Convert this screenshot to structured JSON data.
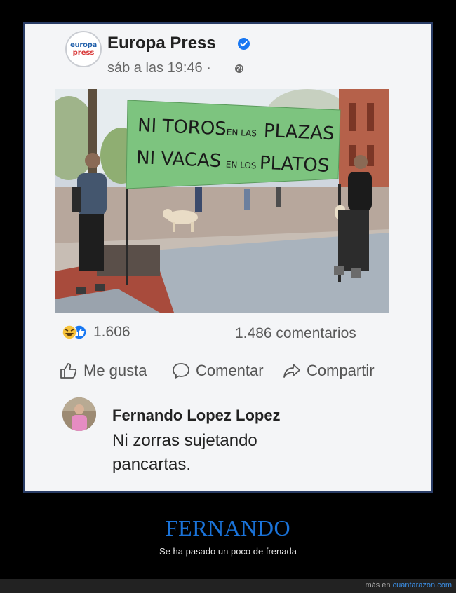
{
  "post": {
    "page_logo": {
      "line1": "europa",
      "line2": "press",
      "brand_blue": "#1f5faa",
      "brand_red": "#d93a3a"
    },
    "page_name": "Europa Press",
    "time": "sáb a las 19:46 ·",
    "verified_color": "#1877f2",
    "image": {
      "banner_line1": [
        "NI TOROS",
        "EN LAS",
        "PLAZAS"
      ],
      "banner_line2": [
        "NI VACAS",
        "EN LOS",
        "PLATOS"
      ],
      "banner_color": "#7dc47f"
    },
    "reaction_icons": [
      "laugh-reaction-icon",
      "like-reaction-icon"
    ],
    "likes_count": "1.606",
    "comments_count": "1.486 comentarios",
    "actions": {
      "like": "Me gusta",
      "comment": "Comentar",
      "share": "Compartir"
    },
    "comment": {
      "author": "Fernando Lopez Lopez",
      "text": "Ni zorras sujetando pancartas."
    }
  },
  "caption": {
    "title": "FERNANDO",
    "subtitle": "Se ha pasado un poco de frenada",
    "accent": "#1a73d9"
  },
  "footer": {
    "prefix": "más en",
    "site": "cuantarazon.com"
  }
}
